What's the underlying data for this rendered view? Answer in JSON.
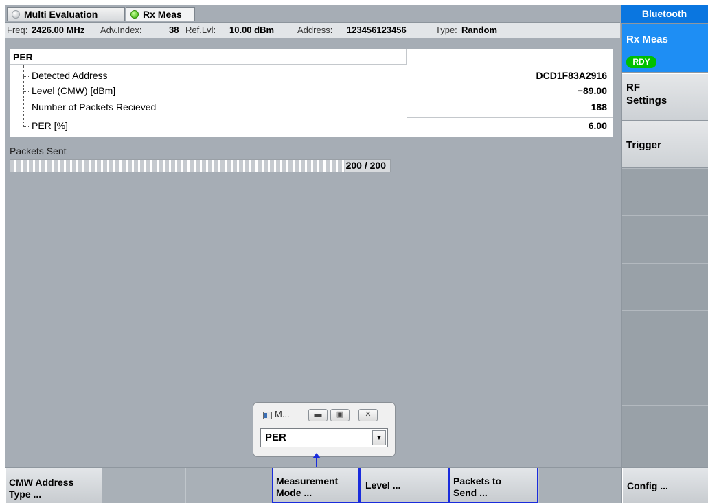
{
  "tabs": [
    {
      "label": "Multi Evaluation"
    },
    {
      "label": "Rx Meas"
    }
  ],
  "info": {
    "freq_label": "Freq:",
    "freq_value": "2426.00 MHz",
    "advindex_label": "Adv.Index:",
    "advindex_value": "38",
    "reflvl_label": "Ref.Lvl:",
    "reflvl_value": "10.00 dBm",
    "address_label": "Address:",
    "address_value": "123456123456",
    "type_label": "Type:",
    "type_value": "Random"
  },
  "per_table": {
    "header": "PER",
    "rows": [
      {
        "name": "Detected Address",
        "value": "DCD1F83A2916"
      },
      {
        "name": "Level (CMW) [dBm]",
        "value": "−89.00"
      },
      {
        "name": "Number of Packets Recieved",
        "value": "188"
      },
      {
        "name": "PER [%]",
        "value": "6.00"
      }
    ]
  },
  "packets": {
    "label": "Packets Sent",
    "text": "200 / 200",
    "progress_fraction": 1.0
  },
  "side": {
    "title": "Bluetooth",
    "rx_meas": "Rx Meas",
    "rx_status": "RDY",
    "rf_settings": "RF\nSettings",
    "trigger": "Trigger"
  },
  "mini_dialog": {
    "title": "M...",
    "select_value": "PER"
  },
  "softkeys": [
    {
      "label": "CMW Address\nType ..."
    },
    {
      "label": "Measurement\nMode ..."
    },
    {
      "label": "Level ..."
    },
    {
      "label": "Packets to\nSend ..."
    },
    {
      "label": "Config ..."
    }
  ],
  "colors": {
    "background": "#a6adb5",
    "title_blue": "#0a76e0",
    "active_blue": "#1e8ef4",
    "ready_green": "#00c000",
    "highlight_border": "#1a2cdc"
  }
}
